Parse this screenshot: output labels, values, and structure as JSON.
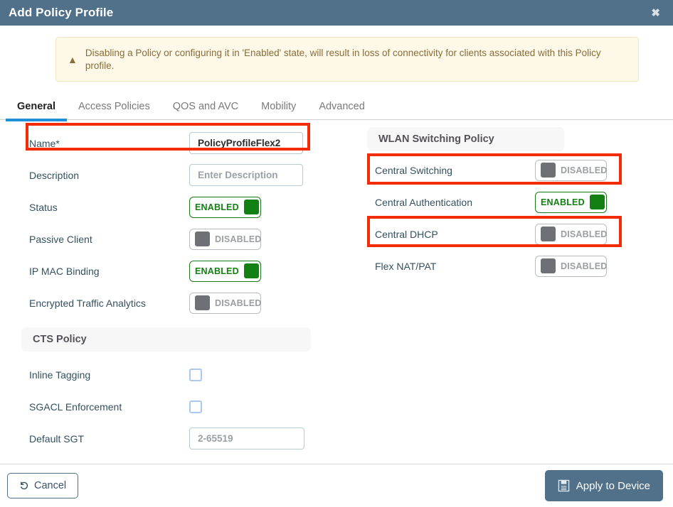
{
  "window": {
    "title": "Add Policy Profile",
    "close_icon": "close-icon",
    "titlebar_color": "#51708a"
  },
  "alert": {
    "icon": "warning-triangle-icon",
    "text": "Disabling a Policy or configuring it in 'Enabled' state, will result in loss of connectivity for clients associated with this Policy profile.",
    "background": "#fdf8e7",
    "text_color": "#8a6d3b"
  },
  "tabs": {
    "active_index": 0,
    "accent_color": "#1f8fd8",
    "items": [
      {
        "label": "General"
      },
      {
        "label": "Access Policies"
      },
      {
        "label": "QOS and AVC"
      },
      {
        "label": "Mobility"
      },
      {
        "label": "Advanced"
      }
    ]
  },
  "left_column": {
    "fields": [
      {
        "label": "Name*",
        "type": "text",
        "value": "PolicyProfileFlex2",
        "placeholder": ""
      },
      {
        "label": "Description",
        "type": "text",
        "value": "",
        "placeholder": "Enter Description"
      },
      {
        "label": "Status",
        "type": "toggle",
        "state": "ENABLED"
      },
      {
        "label": "Passive Client",
        "type": "toggle",
        "state": "DISABLED"
      },
      {
        "label": "IP MAC Binding",
        "type": "toggle",
        "state": "ENABLED"
      },
      {
        "label": "Encrypted Traffic Analytics",
        "type": "toggle",
        "state": "DISABLED"
      }
    ],
    "cts_section": {
      "title": "CTS Policy",
      "fields": [
        {
          "label": "Inline Tagging",
          "type": "checkbox",
          "checked": false
        },
        {
          "label": "SGACL Enforcement",
          "type": "checkbox",
          "checked": false
        },
        {
          "label": "Default SGT",
          "type": "text",
          "value": "",
          "placeholder": "2-65519"
        }
      ]
    }
  },
  "right_column": {
    "section": {
      "title": "WLAN Switching Policy",
      "fields": [
        {
          "label": "Central Switching",
          "type": "toggle",
          "state": "DISABLED"
        },
        {
          "label": "Central Authentication",
          "type": "toggle",
          "state": "ENABLED"
        },
        {
          "label": "Central DHCP",
          "type": "toggle",
          "state": "DISABLED"
        },
        {
          "label": "Flex NAT/PAT",
          "type": "toggle",
          "state": "DISABLED"
        }
      ]
    }
  },
  "toggle_labels": {
    "on": "ENABLED",
    "off": "DISABLED"
  },
  "footer": {
    "cancel_label": "Cancel",
    "cancel_icon": "undo-arrow-icon",
    "apply_label": "Apply to Device",
    "apply_icon": "save-floppy-icon"
  },
  "annotations": {
    "highlight_color": "#f32b06",
    "boxes": [
      {
        "name": "name-field-highlight"
      },
      {
        "name": "central-switching-highlight"
      },
      {
        "name": "central-dhcp-highlight"
      }
    ]
  }
}
